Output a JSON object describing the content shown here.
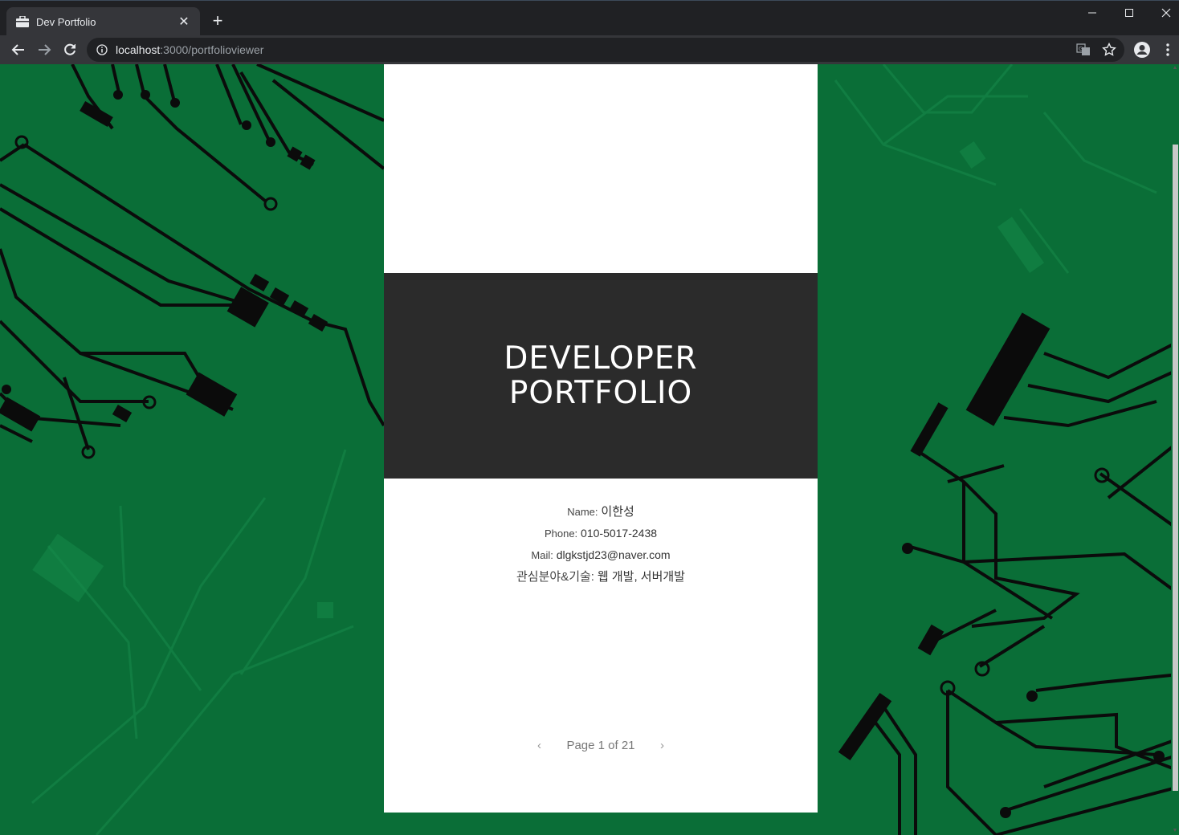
{
  "browser": {
    "tab_title": "Dev Portfolio",
    "tab_close": "✕",
    "new_tab": "+",
    "url_host": "localhost",
    "url_path": ":3000/portfolioviewer"
  },
  "document": {
    "title_line1": "DEVELOPER",
    "title_line2": "PORTFOLIO",
    "name_label": "Name:",
    "name_value": "이한성",
    "phone_label": "Phone:",
    "phone_value": "010-5017-2438",
    "mail_label": "Mail:",
    "mail_value": "dlgkstjd23@naver.com",
    "interest_label": "관심분야&기술:",
    "interest_value": "웹 개발, 서버개발"
  },
  "pager": {
    "prev": "‹",
    "text": "Page 1 of 21",
    "next": "›",
    "current_page": 1,
    "total_pages": 21
  },
  "colors": {
    "background_green": "#0a6e37",
    "title_band": "#2b2b2b",
    "chrome_dark": "#202124",
    "chrome_toolbar": "#35363a"
  }
}
